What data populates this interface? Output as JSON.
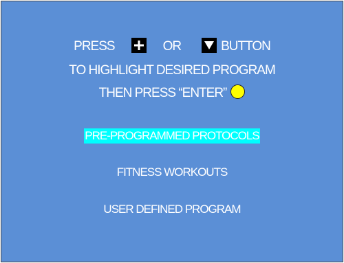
{
  "instructions": {
    "press": "PRESS",
    "or": "OR",
    "button": "BUTTON",
    "line2": "TO HIGHLIGHT DESIRED PROGRAM",
    "line3": "THEN PRESS “ENTER”"
  },
  "icons": {
    "up_key": "up-arrow-key-icon",
    "down_key": "down-arrow-key-icon",
    "enter": "enter-button-icon"
  },
  "colors": {
    "background": "#5b8fd6",
    "highlight": "#00ffff",
    "enter": "#ffff00",
    "text": "#ffffff"
  },
  "menu": {
    "items": [
      {
        "label": "PRE-PROGRAMMED PROTOCOLS",
        "selected": true
      },
      {
        "label": "FITNESS WORKOUTS",
        "selected": false
      },
      {
        "label": "USER DEFINED PROGRAM",
        "selected": false
      }
    ]
  }
}
